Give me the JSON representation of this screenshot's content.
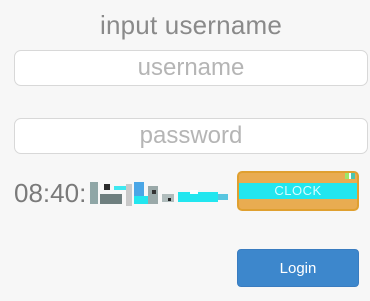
{
  "form": {
    "title": "input username",
    "username_placeholder": "username",
    "password_placeholder": "password"
  },
  "clock": {
    "time_text": "08:40:",
    "button_label": "CLOCK"
  },
  "actions": {
    "login_label": "Login"
  },
  "colors": {
    "background": "#f7f7f7",
    "login_button": "#3d87cc",
    "clock_button": "#e9ac51",
    "glitch_cyan": "#22e6ef"
  }
}
